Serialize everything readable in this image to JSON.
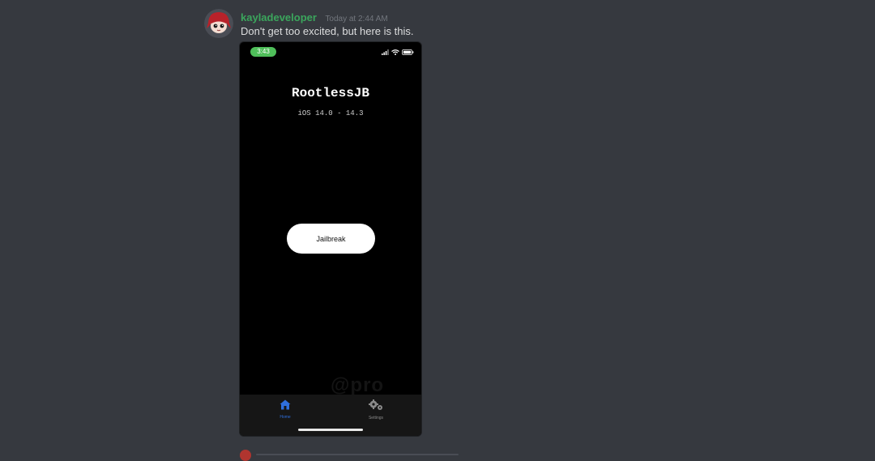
{
  "message": {
    "username": "kayladeveloper",
    "timestamp": "Today at 2:44 AM",
    "text": "Don't get too excited, but here is this."
  },
  "phone": {
    "status_time": "3:43",
    "app_title": "RootlessJB",
    "app_subtitle": "iOS 14.0 - 14.3",
    "button_label": "Jailbreak",
    "tabs": [
      {
        "label": "Home",
        "icon": "house-icon",
        "active": true
      },
      {
        "label": "Settings",
        "icon": "gears-icon",
        "active": false
      }
    ]
  },
  "colors": {
    "background": "#36393f",
    "username": "#3ba55c",
    "status_pill": "#4fbf5a",
    "active_tab": "#2f6fdc"
  }
}
